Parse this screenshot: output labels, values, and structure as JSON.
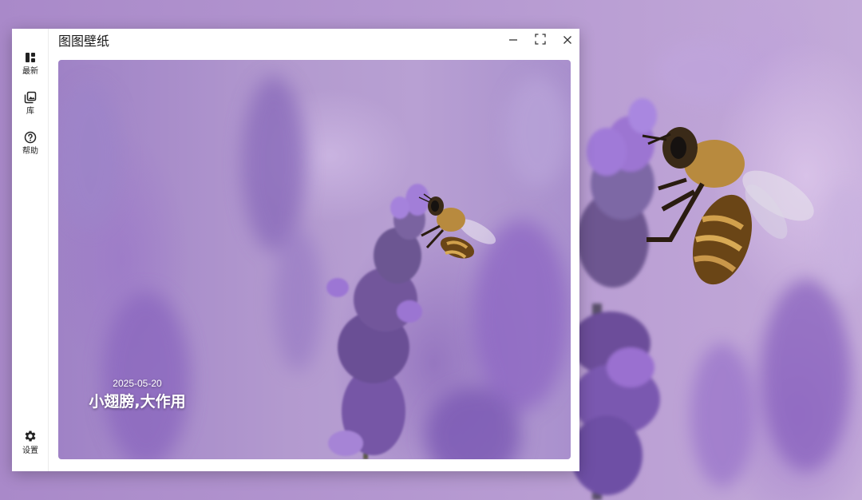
{
  "app": {
    "title": "图图壁纸"
  },
  "sidebar": {
    "items": [
      {
        "label": "最新",
        "icon": "dashboard-icon"
      },
      {
        "label": "库",
        "icon": "gallery-icon"
      },
      {
        "label": "帮助",
        "icon": "help-icon"
      }
    ],
    "settings": {
      "label": "设置",
      "icon": "gear-icon"
    }
  },
  "window_controls": {
    "minimize": "minimize-icon",
    "maximize": "fullscreen-icon",
    "close": "close-icon"
  },
  "wallpaper": {
    "date": "2025-05-20",
    "title": "小翅膀,大作用",
    "subject": "bee-on-lavender"
  },
  "colors": {
    "window_bg": "#ffffff",
    "text": "#1a1a1a",
    "lavender": "#9f82c6",
    "caption": "#ffffff"
  }
}
